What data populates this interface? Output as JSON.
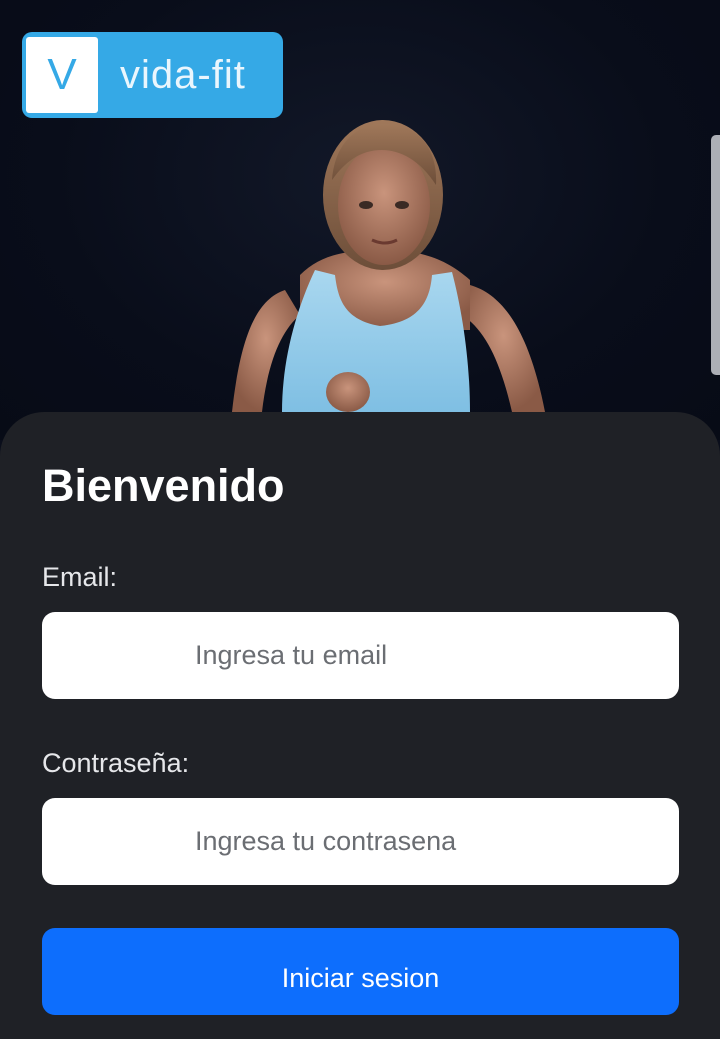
{
  "logo": {
    "mark": "V",
    "text": "vida-fit"
  },
  "hero": {
    "image": "woman-running-photo"
  },
  "login": {
    "title": "Bienvenido",
    "email_label": "Email:",
    "email_placeholder": "Ingresa tu email",
    "email_value": "",
    "password_label": "Contraseña:",
    "password_placeholder": "Ingresa tu contrasena",
    "password_value": "",
    "submit_label": "Iniciar sesion"
  },
  "colors": {
    "brand": "#35a9e6",
    "sheet": "#1f2126",
    "button": "#0d6efd",
    "background": "#0a0e1b"
  }
}
